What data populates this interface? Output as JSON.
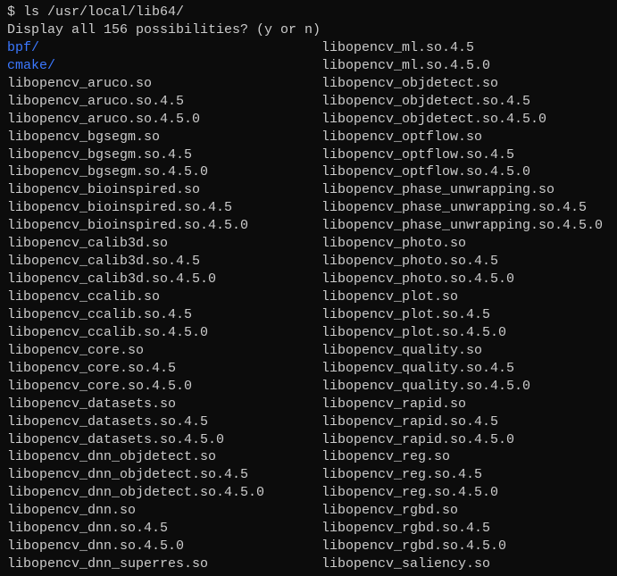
{
  "prompt": {
    "symbol": "$",
    "command": "ls /usr/local/lib64/"
  },
  "question": "Display all 156 possibilities? (y or n)",
  "columns": {
    "left": [
      {
        "name": "bpf/",
        "type": "directory"
      },
      {
        "name": "cmake/",
        "type": "directory"
      },
      {
        "name": "libopencv_aruco.so",
        "type": "file"
      },
      {
        "name": "libopencv_aruco.so.4.5",
        "type": "file"
      },
      {
        "name": "libopencv_aruco.so.4.5.0",
        "type": "file"
      },
      {
        "name": "libopencv_bgsegm.so",
        "type": "file"
      },
      {
        "name": "libopencv_bgsegm.so.4.5",
        "type": "file"
      },
      {
        "name": "libopencv_bgsegm.so.4.5.0",
        "type": "file"
      },
      {
        "name": "libopencv_bioinspired.so",
        "type": "file"
      },
      {
        "name": "libopencv_bioinspired.so.4.5",
        "type": "file"
      },
      {
        "name": "libopencv_bioinspired.so.4.5.0",
        "type": "file"
      },
      {
        "name": "libopencv_calib3d.so",
        "type": "file"
      },
      {
        "name": "libopencv_calib3d.so.4.5",
        "type": "file"
      },
      {
        "name": "libopencv_calib3d.so.4.5.0",
        "type": "file"
      },
      {
        "name": "libopencv_ccalib.so",
        "type": "file"
      },
      {
        "name": "libopencv_ccalib.so.4.5",
        "type": "file"
      },
      {
        "name": "libopencv_ccalib.so.4.5.0",
        "type": "file"
      },
      {
        "name": "libopencv_core.so",
        "type": "file"
      },
      {
        "name": "libopencv_core.so.4.5",
        "type": "file"
      },
      {
        "name": "libopencv_core.so.4.5.0",
        "type": "file"
      },
      {
        "name": "libopencv_datasets.so",
        "type": "file"
      },
      {
        "name": "libopencv_datasets.so.4.5",
        "type": "file"
      },
      {
        "name": "libopencv_datasets.so.4.5.0",
        "type": "file"
      },
      {
        "name": "libopencv_dnn_objdetect.so",
        "type": "file"
      },
      {
        "name": "libopencv_dnn_objdetect.so.4.5",
        "type": "file"
      },
      {
        "name": "libopencv_dnn_objdetect.so.4.5.0",
        "type": "file"
      },
      {
        "name": "libopencv_dnn.so",
        "type": "file"
      },
      {
        "name": "libopencv_dnn.so.4.5",
        "type": "file"
      },
      {
        "name": "libopencv_dnn.so.4.5.0",
        "type": "file"
      },
      {
        "name": "libopencv_dnn_superres.so",
        "type": "file"
      }
    ],
    "right": [
      {
        "name": "libopencv_ml.so.4.5",
        "type": "file"
      },
      {
        "name": "libopencv_ml.so.4.5.0",
        "type": "file"
      },
      {
        "name": "libopencv_objdetect.so",
        "type": "file"
      },
      {
        "name": "libopencv_objdetect.so.4.5",
        "type": "file"
      },
      {
        "name": "libopencv_objdetect.so.4.5.0",
        "type": "file"
      },
      {
        "name": "libopencv_optflow.so",
        "type": "file"
      },
      {
        "name": "libopencv_optflow.so.4.5",
        "type": "file"
      },
      {
        "name": "libopencv_optflow.so.4.5.0",
        "type": "file"
      },
      {
        "name": "libopencv_phase_unwrapping.so",
        "type": "file"
      },
      {
        "name": "libopencv_phase_unwrapping.so.4.5",
        "type": "file"
      },
      {
        "name": "libopencv_phase_unwrapping.so.4.5.0",
        "type": "file"
      },
      {
        "name": "libopencv_photo.so",
        "type": "file"
      },
      {
        "name": "libopencv_photo.so.4.5",
        "type": "file"
      },
      {
        "name": "libopencv_photo.so.4.5.0",
        "type": "file"
      },
      {
        "name": "libopencv_plot.so",
        "type": "file"
      },
      {
        "name": "libopencv_plot.so.4.5",
        "type": "file"
      },
      {
        "name": "libopencv_plot.so.4.5.0",
        "type": "file"
      },
      {
        "name": "libopencv_quality.so",
        "type": "file"
      },
      {
        "name": "libopencv_quality.so.4.5",
        "type": "file"
      },
      {
        "name": "libopencv_quality.so.4.5.0",
        "type": "file"
      },
      {
        "name": "libopencv_rapid.so",
        "type": "file"
      },
      {
        "name": "libopencv_rapid.so.4.5",
        "type": "file"
      },
      {
        "name": "libopencv_rapid.so.4.5.0",
        "type": "file"
      },
      {
        "name": "libopencv_reg.so",
        "type": "file"
      },
      {
        "name": "libopencv_reg.so.4.5",
        "type": "file"
      },
      {
        "name": "libopencv_reg.so.4.5.0",
        "type": "file"
      },
      {
        "name": "libopencv_rgbd.so",
        "type": "file"
      },
      {
        "name": "libopencv_rgbd.so.4.5",
        "type": "file"
      },
      {
        "name": "libopencv_rgbd.so.4.5.0",
        "type": "file"
      },
      {
        "name": "libopencv_saliency.so",
        "type": "file"
      }
    ]
  }
}
